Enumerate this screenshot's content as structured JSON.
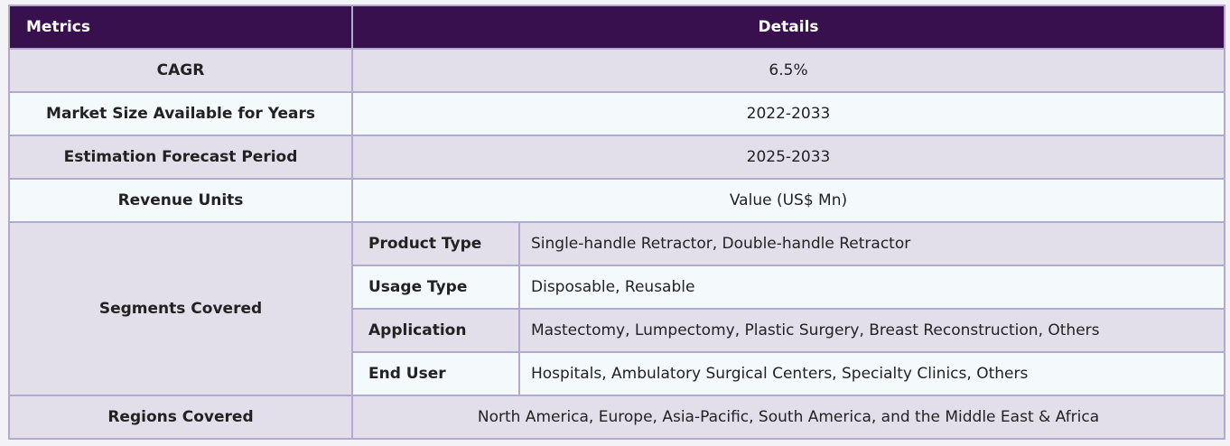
{
  "table": {
    "header": {
      "metrics": "Metrics",
      "details": "Details"
    },
    "cagr": {
      "label": "CAGR",
      "value": "6.5%"
    },
    "market_size": {
      "label": "Market Size Available for Years",
      "value": "2022-2033"
    },
    "forecast": {
      "label": "Estimation Forecast Period",
      "value": "2025-2033"
    },
    "revenue": {
      "label": "Revenue Units",
      "value": "Value (US$ Mn)"
    },
    "segments": {
      "label": "Segments Covered",
      "items": [
        {
          "label": "Product Type",
          "value": "Single-handle Retractor, Double-handle Retractor"
        },
        {
          "label": "Usage Type",
          "value": "Disposable, Reusable"
        },
        {
          "label": "Application",
          "value": "Mastectomy, Lumpectomy, Plastic Surgery, Breast Reconstruction, Others"
        },
        {
          "label": "End User",
          "value": "Hospitals, Ambulatory Surgical Centers, Specialty Clinics, Others"
        }
      ]
    },
    "regions": {
      "label": "Regions Covered",
      "value": "North America, Europe, Asia-Pacific, South America, and the Middle East & Africa"
    }
  },
  "colors": {
    "header_bg": "#38104d",
    "row_alt_a": "#e2dfeb",
    "row_alt_b": "#f4fafc",
    "border": "#b3a9cc"
  }
}
